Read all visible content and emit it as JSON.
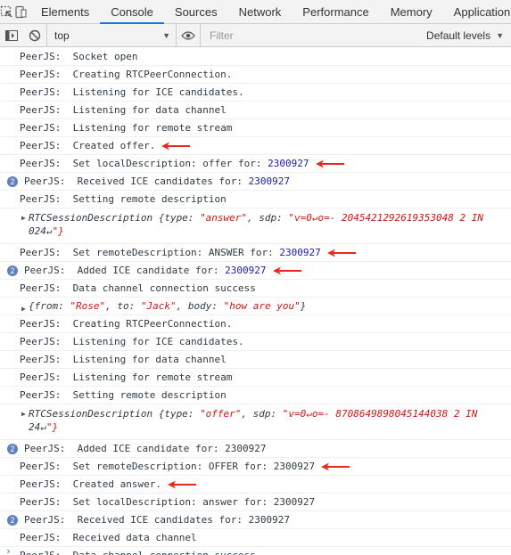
{
  "tabs": [
    "Elements",
    "Console",
    "Sources",
    "Network",
    "Performance",
    "Memory",
    "Application"
  ],
  "active_tab": "Console",
  "toolbar": {
    "context": "top",
    "filter_placeholder": "Filter",
    "levels": "Default levels"
  },
  "rows": [
    {
      "text": "PeerJS:  Socket open"
    },
    {
      "text": "PeerJS:  Creating RTCPeerConnection."
    },
    {
      "text": "PeerJS:  Listening for ICE candidates."
    },
    {
      "text": "PeerJS:  Listening for data channel"
    },
    {
      "text": "PeerJS:  Listening for remote stream"
    },
    {
      "text": "PeerJS:  Created offer.",
      "arrow": true
    },
    {
      "text": "PeerJS:  Set localDescription: offer for: ",
      "num": "2300927",
      "arrow": true
    },
    {
      "text": "PeerJS:  Received ICE candidates for: ",
      "num": "2300927",
      "badge": "2"
    },
    {
      "text": "PeerJS:  Setting remote description"
    },
    {
      "object": {
        "line1": "RTCSessionDescription {type: \"answer\", sdp: \"v=0↵o=- 2045421292619353048 2 IN",
        "line2": "024↵\"}"
      }
    },
    {
      "text": "PeerJS:  Set remoteDescription: ANSWER for: ",
      "num": "2300927",
      "arrow": true
    },
    {
      "text": "PeerJS:  Added ICE candidate for: ",
      "num": "2300927",
      "badge": "2",
      "arrow": true
    },
    {
      "text": "PeerJS:  Data channel connection success"
    },
    {
      "object": {
        "line1": "{from: \"Rose\", to: \"Jack\", body: \"how are you\"}"
      }
    },
    {
      "text": "PeerJS:  Creating RTCPeerConnection."
    },
    {
      "text": "PeerJS:  Listening for ICE candidates."
    },
    {
      "text": "PeerJS:  Listening for data channel"
    },
    {
      "text": "PeerJS:  Listening for remote stream"
    },
    {
      "text": "PeerJS:  Setting remote description"
    },
    {
      "object": {
        "line1": "RTCSessionDescription {type: \"offer\", sdp: \"v=0↵o=- 8708649898045144038 2 IN",
        "line2": "24↵\"}"
      }
    },
    {
      "text": "PeerJS:  Added ICE candidate for: 2300927",
      "badge": "2"
    },
    {
      "text": "PeerJS:  Set remoteDescription: OFFER for: 2300927",
      "arrow": true
    },
    {
      "text": "PeerJS:  Created answer.",
      "arrow": true
    },
    {
      "text": "PeerJS:  Set localDescription: answer for: 2300927"
    },
    {
      "text": "PeerJS:  Received ICE candidates for: 2300927",
      "badge": "2"
    },
    {
      "text": "PeerJS:  Received data channel"
    },
    {
      "text": "PeerJS:  Data channel connection success"
    }
  ],
  "prompt": "›",
  "colors": {
    "arrow": "#e8281e",
    "badge": "#5f7fc0",
    "active_tab": "#1a73e8",
    "number": "#1a1aa6"
  }
}
